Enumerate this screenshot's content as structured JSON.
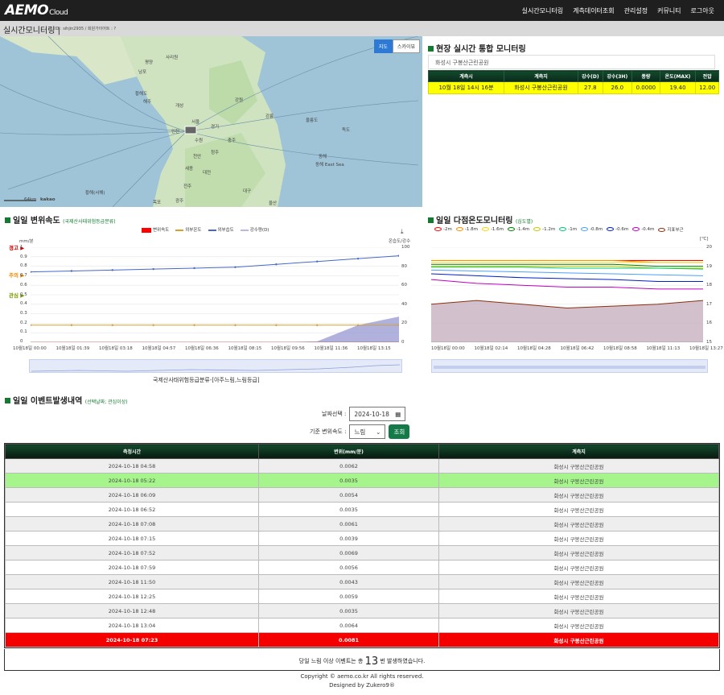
{
  "app": {
    "logo": "AEMO",
    "logo_sub": "Cloud",
    "nav": [
      "실시간모니터링",
      "계측데이터조회",
      "관리설정",
      "커뮤니티",
      "로그아웃"
    ]
  },
  "subbar": {
    "title": "실시간모니터링",
    "sep": "|",
    "info": "ID : sihjin2935 / 회원가이어트 : ?"
  },
  "map": {
    "btn_map": "지도",
    "btn_sky": "스카이뷰",
    "attribution": "kakao",
    "scale": "64km",
    "labels": [
      "평양",
      "남포",
      "사리원",
      "황해도",
      "해주",
      "개성",
      "서울",
      "인천",
      "수원",
      "천안",
      "세종",
      "대전",
      "충주",
      "강원",
      "강릉",
      "동해",
      "청주",
      "전주",
      "대구",
      "광주",
      "목포",
      "울산",
      "독도",
      "울릉도",
      "황해(서해)",
      "동해 East Sea",
      "경기"
    ]
  },
  "realtime": {
    "title": "현장 실시간 통합 모니터링",
    "site_name": "화성시 구봉산근린공원",
    "headers": [
      "계측시",
      "계측지",
      "강수(D)",
      "강수(3H)",
      "풍량",
      "온도(MAX)",
      "전압"
    ],
    "row": [
      "10월 18일 14시 16분",
      "화성시 구봉산근린공원",
      "27.8",
      "26.0",
      "0.0000",
      "19.40",
      "12.00"
    ]
  },
  "disp": {
    "title": "일일 변위속도",
    "subtitle": "(국제산사태위험등급분류)",
    "legend": [
      "변위속도",
      "외부온도",
      "외부습도",
      "강수량(D)"
    ],
    "left_unit": "mm/분",
    "right_unit": "온습도/강수",
    "y_left": [
      "1",
      "0.9",
      "0.8",
      "0.7",
      "0.6",
      "0.5",
      "0.4",
      "0.3",
      "0.2",
      "0.1",
      "0"
    ],
    "y_right": [
      "100",
      "80",
      "60",
      "40",
      "20",
      "0"
    ],
    "x": [
      "10월18일 00:00",
      "10월18일 01:39",
      "10월18일 03:18",
      "10월18일 04:57",
      "10월18일 06:36",
      "10월18일 08:15",
      "10월18일 09:56",
      "10월18일 11:36",
      "10월18일 13:15"
    ],
    "levels": [
      "경고",
      "주의",
      "관심"
    ],
    "caption": "국제산사태위험등급분류-[아주느림,느림등급]",
    "level_colors": [
      "#d40000",
      "#f08a00",
      "#7a9a00"
    ]
  },
  "temp": {
    "title": "일일 다점온도모니터링",
    "subtitle": "(심도별)",
    "legend": [
      "-2m",
      "-1.8m",
      "-1.6m",
      "-1.4m",
      "-1.2m",
      "-1m",
      "-0.8m",
      "-0.6m",
      "-0.4m",
      "지표부근"
    ],
    "colors": [
      "#ff0000",
      "#ff8c00",
      "#ffd700",
      "#008000",
      "#c8c800",
      "#00c878",
      "#4aa0ff",
      "#0020c8",
      "#c000c0",
      "#8b3010"
    ],
    "unit": "[℃]",
    "y": [
      "20",
      "19",
      "18",
      "17",
      "16",
      "15"
    ],
    "x": [
      "10월18일 00:00",
      "10월18일 02:14",
      "10월18일 04:28",
      "10월18일 06:42",
      "10월18일 08:58",
      "10월18일 11:13",
      "10월18일 13:27"
    ]
  },
  "events": {
    "title": "일일 이벤트발생내역",
    "subtitle": "(선택날짜; 관심이상)",
    "date_label": "날짜선택 :",
    "date_value": "2024-10-18",
    "speed_label": "기준 변위속도 :",
    "speed_value": "느림",
    "search": "조회",
    "headers": [
      "측정시간",
      "변위(mm/분)",
      "계측지"
    ],
    "rows": [
      [
        "2024-10-18 04:58",
        "0.0062",
        "화성시 구봉산근린공원"
      ],
      [
        "2024-10-18 05:22",
        "0.0035",
        "화성시 구봉산근린공원"
      ],
      [
        "2024-10-18 06:09",
        "0.0054",
        "화성시 구봉산근린공원"
      ],
      [
        "2024-10-18 06:52",
        "0.0035",
        "화성시 구봉산근린공원"
      ],
      [
        "2024-10-18 07:08",
        "0.0061",
        "화성시 구봉산근린공원"
      ],
      [
        "2024-10-18 07:15",
        "0.0039",
        "화성시 구봉산근린공원"
      ],
      [
        "2024-10-18 07:52",
        "0.0069",
        "화성시 구봉산근린공원"
      ],
      [
        "2024-10-18 07:59",
        "0.0056",
        "화성시 구봉산근린공원"
      ],
      [
        "2024-10-18 11:50",
        "0.0043",
        "화성시 구봉산근린공원"
      ],
      [
        "2024-10-18 12:25",
        "0.0059",
        "화성시 구봉산근린공원"
      ],
      [
        "2024-10-18 12:48",
        "0.0035",
        "화성시 구봉산근린공원"
      ],
      [
        "2024-10-18 13:04",
        "0.0064",
        "화성시 구봉산근린공원"
      ],
      [
        "2024-10-18 07:23",
        "0.0081",
        "화성시 구봉산근린공원"
      ]
    ],
    "summary_pre": "당일 느림 이상 이벤트는 총",
    "summary_count": "13",
    "summary_post": "번 발생하였습니다."
  },
  "footer": {
    "copyright": "Copyright © aemo.co.kr All rights reserved.",
    "designed": "Designed by Zukero9®"
  },
  "chart_data": [
    {
      "type": "line",
      "title": "일일 변위속도",
      "x": [
        "10월18일 00:00",
        "10월18일 01:39",
        "10월18일 03:18",
        "10월18일 04:57",
        "10월18일 06:36",
        "10월18일 08:15",
        "10월18일 09:56",
        "10월18일 11:36",
        "10월18일 13:15",
        "10월18일 14:16"
      ],
      "ylim_left": [
        0,
        1
      ],
      "ylim_right": [
        0,
        100
      ],
      "series": [
        {
          "name": "변위속도",
          "axis": "left",
          "values": [
            0,
            0,
            0,
            0,
            0,
            0,
            0,
            0,
            0,
            0
          ]
        },
        {
          "name": "외부온도",
          "axis": "right",
          "values": [
            18,
            18,
            18,
            18,
            18,
            18,
            18,
            18,
            18,
            18
          ]
        },
        {
          "name": "외부습도",
          "axis": "right",
          "values": [
            74,
            75,
            76,
            77,
            78,
            79,
            82,
            85,
            88,
            91
          ]
        },
        {
          "name": "강수량(D)",
          "axis": "right",
          "values": [
            0,
            0,
            0,
            0,
            0,
            0,
            0,
            1,
            18,
            27
          ]
        }
      ]
    },
    {
      "type": "line",
      "title": "일일 다점온도모니터링",
      "x": [
        "10월18일 00:00",
        "10월18일 02:14",
        "10월18일 04:28",
        "10월18일 06:42",
        "10월18일 08:58",
        "10월18일 11:13",
        "10월18일 13:27"
      ],
      "ylim": [
        15,
        20
      ],
      "series": [
        {
          "name": "-2m",
          "values": [
            19.3,
            19.3,
            19.3,
            19.3,
            19.3,
            19.3,
            19.3
          ]
        },
        {
          "name": "-1.8m",
          "values": [
            19.3,
            19.3,
            19.3,
            19.3,
            19.3,
            19.2,
            19.2
          ]
        },
        {
          "name": "-1.6m",
          "values": [
            19.2,
            19.2,
            19.2,
            19.2,
            19.2,
            19.2,
            19.2
          ]
        },
        {
          "name": "-1.4m",
          "values": [
            19.1,
            19.1,
            19.1,
            19.1,
            19.1,
            19.0,
            19.0
          ]
        },
        {
          "name": "-1.2m",
          "values": [
            19.0,
            19.0,
            19.0,
            19.0,
            19.0,
            18.9,
            18.9
          ]
        },
        {
          "name": "-1m",
          "values": [
            18.95,
            18.95,
            18.95,
            18.9,
            18.9,
            18.9,
            18.85
          ]
        },
        {
          "name": "-0.8m",
          "values": [
            18.8,
            18.75,
            18.7,
            18.65,
            18.6,
            18.55,
            18.5
          ]
        },
        {
          "name": "-0.6m",
          "values": [
            18.6,
            18.5,
            18.4,
            18.35,
            18.3,
            18.2,
            18.2
          ]
        },
        {
          "name": "-0.4m",
          "values": [
            18.3,
            18.1,
            18.0,
            17.9,
            17.9,
            17.8,
            17.8
          ]
        },
        {
          "name": "지표부근",
          "values": [
            17.0,
            17.2,
            17.0,
            16.8,
            16.9,
            17.0,
            17.2
          ]
        }
      ]
    }
  ]
}
